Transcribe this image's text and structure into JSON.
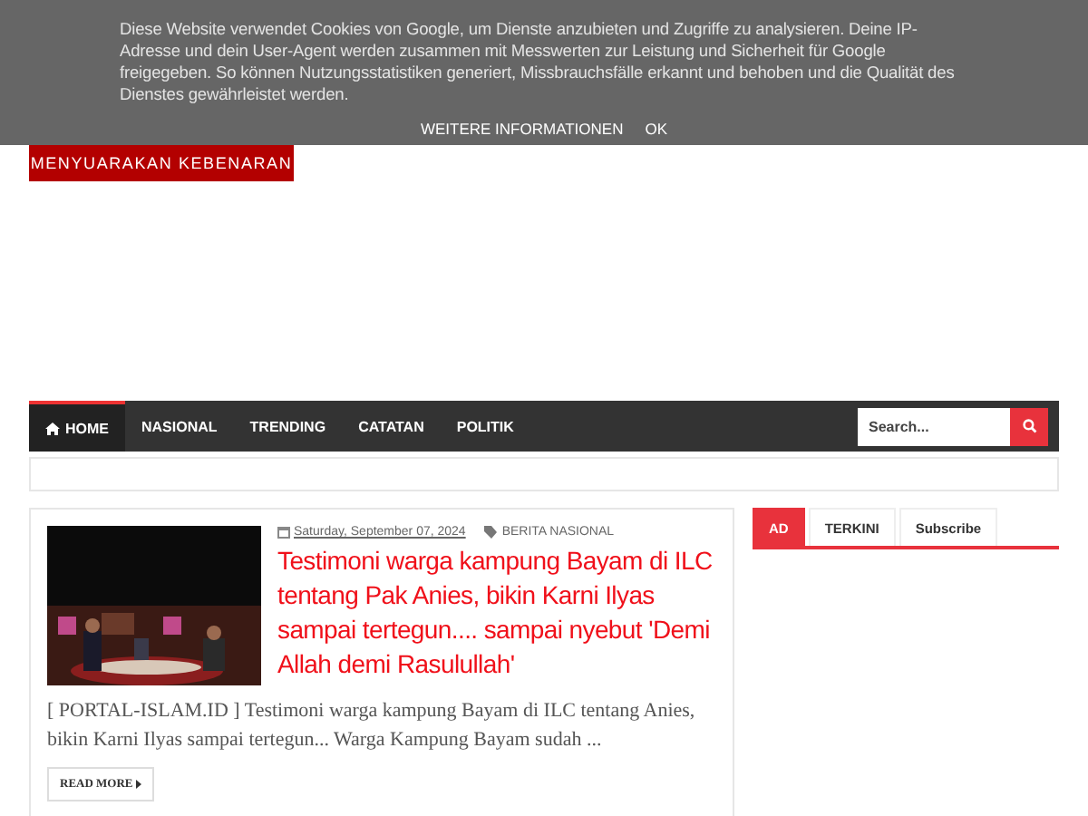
{
  "cookie_notice": {
    "message": "Diese Website verwendet Cookies von Google, um Dienste anzubieten und Zugriffe zu analysieren. Deine IP-Adresse und dein User-Agent werden zusammen mit Messwerten zur Leistung und Sicherheit für Google freigegeben. So können Nutzungsstatistiken generiert, Missbrauchsfälle erkannt und behoben und die Qualität des Dienstes gewährleistet werden.",
    "buttons": [
      "WEITERE INFORMATIONEN",
      "OK"
    ]
  },
  "logo": {
    "tagline": "MENYUARAKAN KEBENARAN"
  },
  "nav": {
    "items": [
      {
        "label": "HOME",
        "selected": true
      },
      {
        "label": "NASIONAL",
        "selected": false
      },
      {
        "label": "TRENDING",
        "selected": false
      },
      {
        "label": "CATATAN",
        "selected": false
      },
      {
        "label": "POLITIK",
        "selected": false
      }
    ],
    "search": {
      "placeholder": "Search..."
    }
  },
  "post": {
    "date": "Saturday, September 07, 2024",
    "category": "BERITA NASIONAL",
    "title": "Testimoni warga kampung Bayam di ILC tentang Pak Anies, bikin Karni Ilyas sampai tertegun.... sampai nyebut 'Demi Allah demi Rasulullah'",
    "excerpt": "[ PORTAL-ISLAM.ID ]   Testimoni warga kampung Bayam di ILC tentang Anies, bikin Karni Ilyas sampai tertegun... Warga Kampung Bayam sudah ...",
    "read_more": "READ MORE"
  },
  "sidebar": {
    "tabs": [
      {
        "label": "AD",
        "selected": true
      },
      {
        "label": "TERKINI",
        "selected": false
      },
      {
        "label": "Subscribe",
        "selected": false
      }
    ]
  }
}
